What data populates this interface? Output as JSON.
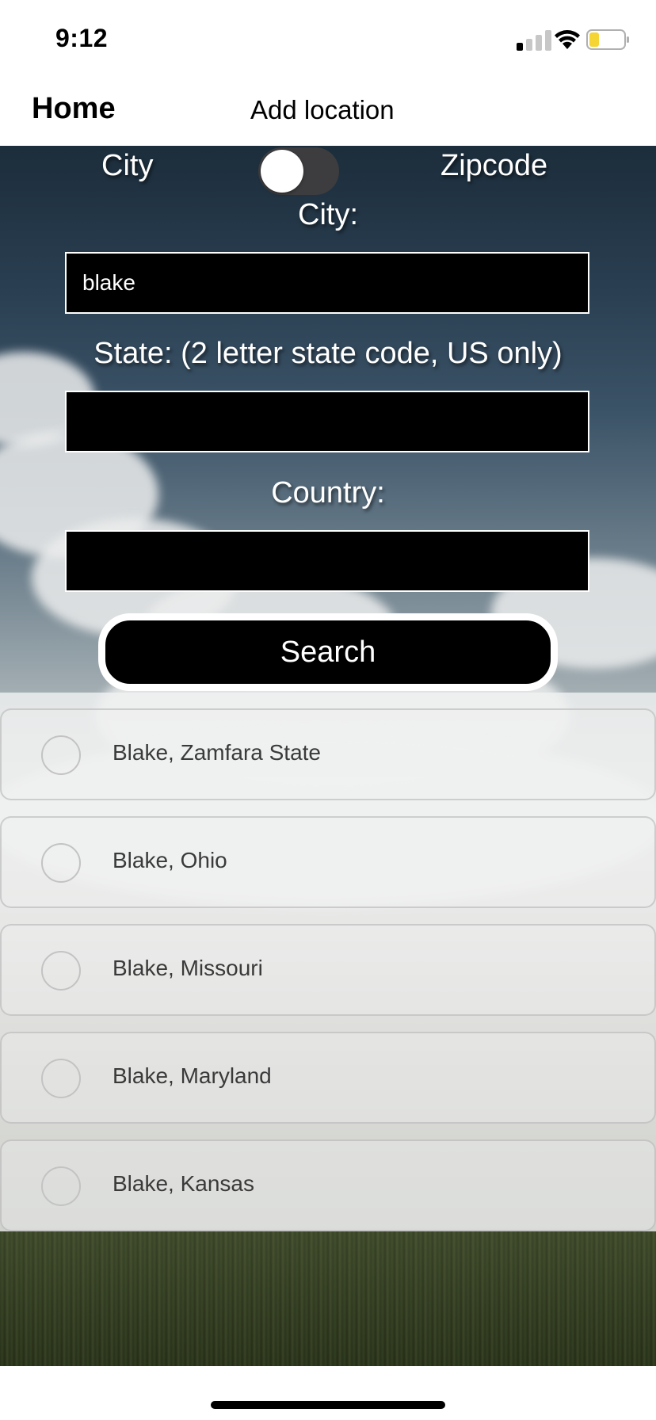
{
  "status_bar": {
    "time": "9:12",
    "icons": [
      "signal-icon",
      "wifi-icon",
      "battery-icon"
    ],
    "battery_color": "#f4d533"
  },
  "nav": {
    "home_label": "Home",
    "title": "Add location"
  },
  "form": {
    "toggle": {
      "left_label": "City",
      "right_label": "Zipcode",
      "on": false
    },
    "city": {
      "label": "City:",
      "value": "blake"
    },
    "state": {
      "label": "State: (2 letter state code, US only)",
      "value": ""
    },
    "country": {
      "label": "Country:",
      "value": ""
    },
    "search_label": "Search"
  },
  "results": [
    {
      "label": "Blake, Zamfara State"
    },
    {
      "label": "Blake, Ohio"
    },
    {
      "label": "Blake, Missouri"
    },
    {
      "label": "Blake, Maryland"
    },
    {
      "label": "Blake, Kansas"
    }
  ],
  "colors": {
    "field_background": "#000000",
    "field_border": "#ffffff",
    "result_text": "#3a3a3a"
  }
}
